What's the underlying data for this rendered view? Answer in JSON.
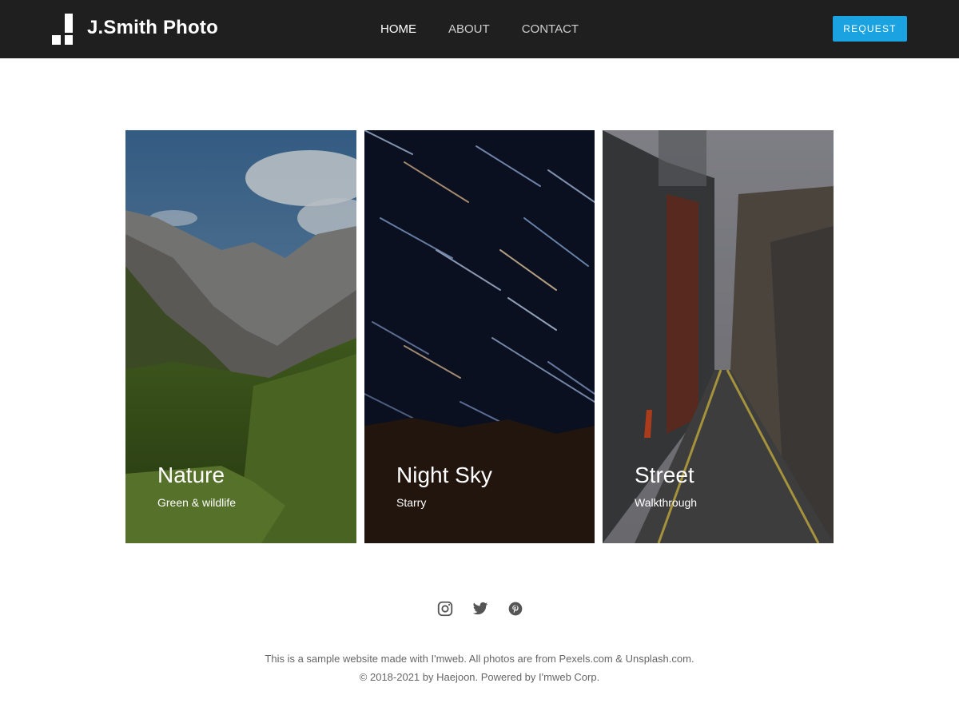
{
  "header": {
    "brand": "J.Smith Photo",
    "nav": [
      {
        "label": "HOME",
        "active": true
      },
      {
        "label": "ABOUT",
        "active": false
      },
      {
        "label": "CONTACT",
        "active": false
      }
    ],
    "request_label": "REQUEST"
  },
  "cards": [
    {
      "title": "Nature",
      "subtitle": "Green & wildlife"
    },
    {
      "title": "Night Sky",
      "subtitle": "Starry"
    },
    {
      "title": "Street",
      "subtitle": "Walkthrough"
    }
  ],
  "social": [
    "instagram-icon",
    "twitter-icon",
    "pinterest-icon"
  ],
  "footer": {
    "line1": "This is a sample website made with I'mweb. All photos are from Pexels.com & Unsplash.com.",
    "line2": "© 2018-2021 by Haejoon. Powered by I'mweb Corp."
  },
  "colors": {
    "header_bg": "#1f1f1f",
    "accent": "#1aa3e0"
  }
}
